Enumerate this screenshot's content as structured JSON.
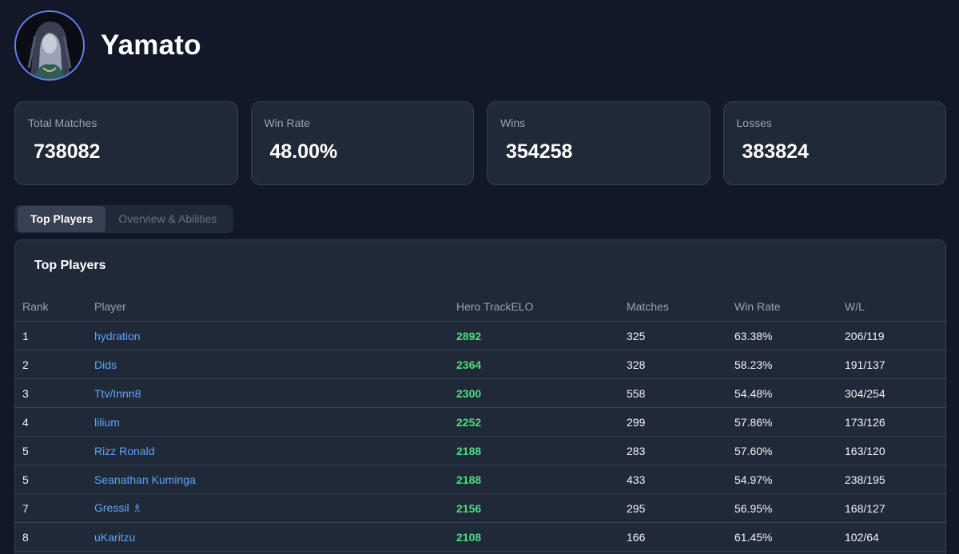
{
  "hero": {
    "name": "Yamato"
  },
  "stats": [
    {
      "label": "Total Matches",
      "value": "738082"
    },
    {
      "label": "Win Rate",
      "value": "48.00%"
    },
    {
      "label": "Wins",
      "value": "354258"
    },
    {
      "label": "Losses",
      "value": "383824"
    }
  ],
  "tabs": [
    {
      "label": "Top Players",
      "active": true
    },
    {
      "label": "Overview & Abilities",
      "active": false
    }
  ],
  "panel": {
    "title": "Top Players",
    "columns": [
      "Rank",
      "Player",
      "Hero TrackELO",
      "Matches",
      "Win Rate",
      "W/L"
    ],
    "rows": [
      {
        "rank": "1",
        "player": "hydration",
        "elo": "2892",
        "matches": "325",
        "win_rate": "63.38%",
        "wl": "206/119"
      },
      {
        "rank": "2",
        "player": "Dids",
        "elo": "2364",
        "matches": "328",
        "win_rate": "58.23%",
        "wl": "191/137"
      },
      {
        "rank": "3",
        "player": "Ttv/Innn8",
        "elo": "2300",
        "matches": "558",
        "win_rate": "54.48%",
        "wl": "304/254"
      },
      {
        "rank": "4",
        "player": "lilium",
        "elo": "2252",
        "matches": "299",
        "win_rate": "57.86%",
        "wl": "173/126"
      },
      {
        "rank": "5",
        "player": "Rizz Ronald",
        "elo": "2188",
        "matches": "283",
        "win_rate": "57.60%",
        "wl": "163/120"
      },
      {
        "rank": "5",
        "player": "Seanathan Kuminga",
        "elo": "2188",
        "matches": "433",
        "win_rate": "54.97%",
        "wl": "238/195"
      },
      {
        "rank": "7",
        "player": "Gressil ♗",
        "elo": "2156",
        "matches": "295",
        "win_rate": "56.95%",
        "wl": "168/127"
      },
      {
        "rank": "8",
        "player": "uKaritzu",
        "elo": "2108",
        "matches": "166",
        "win_rate": "61.45%",
        "wl": "102/64"
      }
    ]
  },
  "colors": {
    "background": "#111827",
    "card": "#1f2937",
    "border": "#374151",
    "link": "#60a5fa",
    "elo": "#4ade80",
    "avatar_ring": "#6b7cf0"
  }
}
